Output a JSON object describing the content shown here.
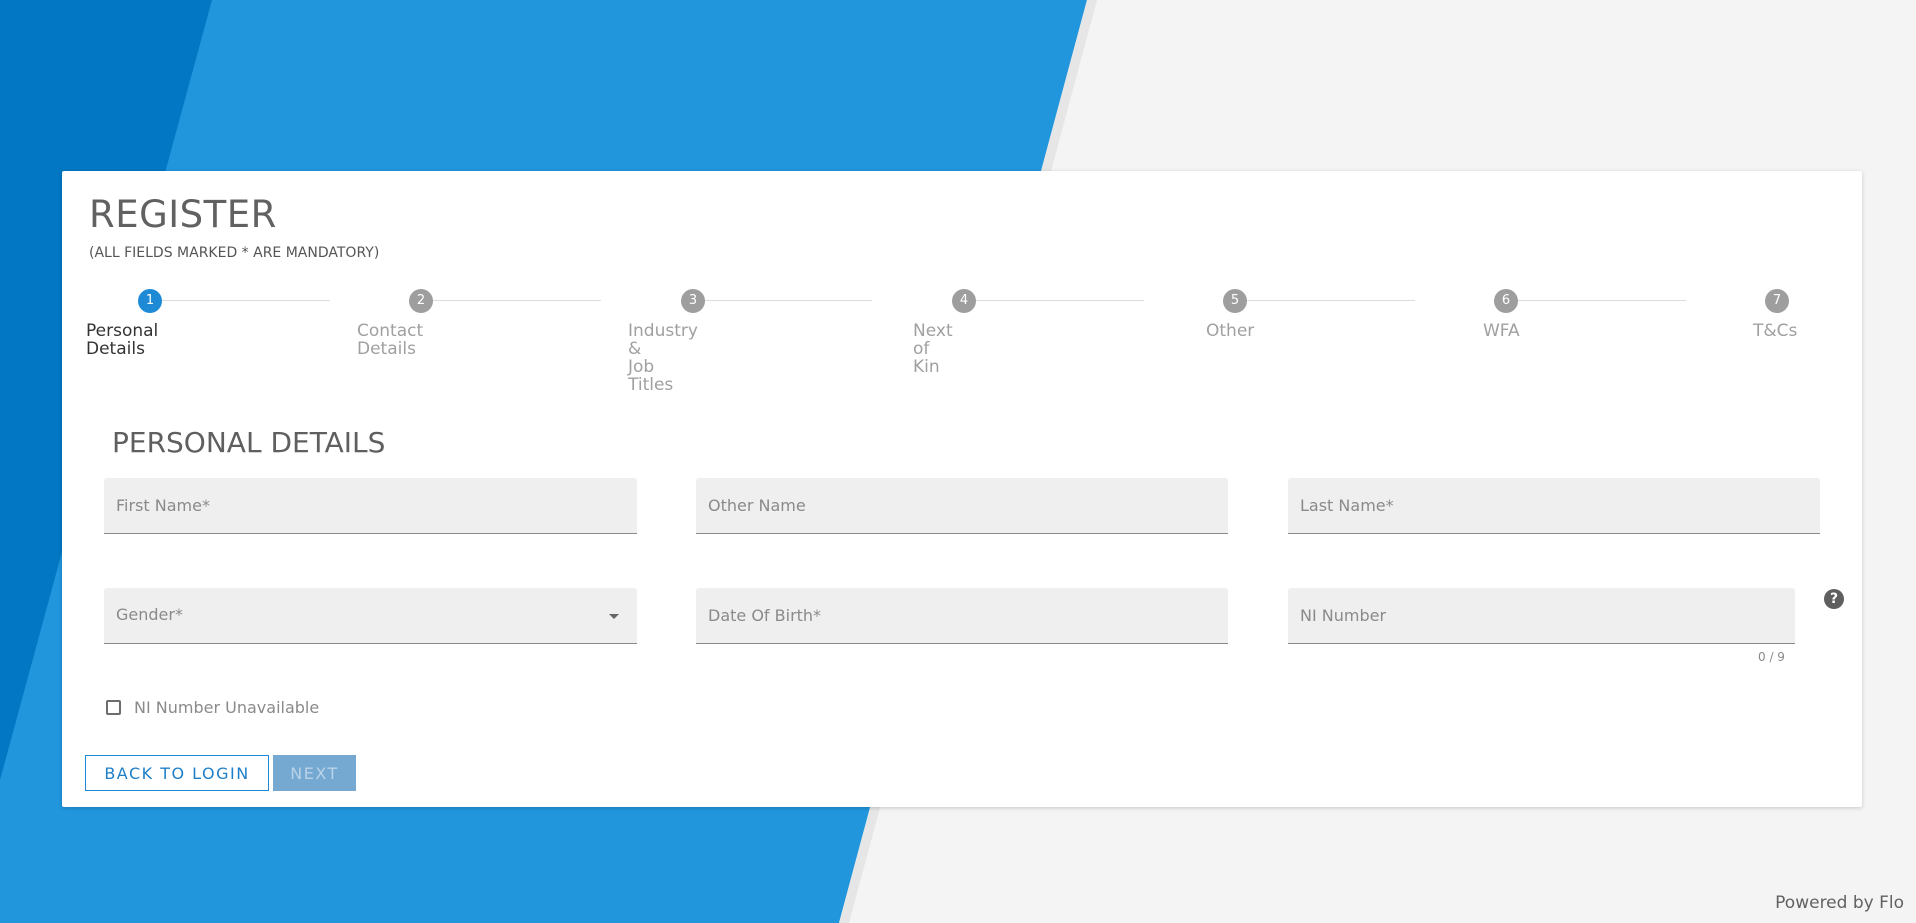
{
  "page": {
    "title": "REGISTER",
    "subtitle": "(ALL FIELDS MARKED * ARE MANDATORY)",
    "footer": "Powered by Flo",
    "colors": {
      "primary": "#1e8ad6",
      "background_blue": "#2196dd",
      "background_dark_blue": "#0277c4",
      "page_bg": "#f4f4f4"
    }
  },
  "stepper": {
    "active_index": 0,
    "steps": [
      {
        "number": "1",
        "label": "Personal\nDetails"
      },
      {
        "number": "2",
        "label": "Contact\nDetails"
      },
      {
        "number": "3",
        "label": "Industry &\nJob Titles"
      },
      {
        "number": "4",
        "label": "Next of Kin"
      },
      {
        "number": "5",
        "label": "Other"
      },
      {
        "number": "6",
        "label": "WFA"
      },
      {
        "number": "7",
        "label": "T&Cs"
      }
    ]
  },
  "form": {
    "section_title": "PERSONAL DETAILS",
    "first_name": {
      "placeholder": "First Name*",
      "value": ""
    },
    "other_name": {
      "placeholder": "Other Name",
      "value": ""
    },
    "last_name": {
      "placeholder": "Last Name*",
      "value": ""
    },
    "gender": {
      "placeholder": "Gender*"
    },
    "date_of_birth": {
      "placeholder": "Date Of Birth*",
      "value": ""
    },
    "ni_number": {
      "placeholder": "NI Number",
      "value": "",
      "counter": "0 / 9"
    },
    "help_icon": "question-circle-icon",
    "help_glyph": "?",
    "ni_unavailable": {
      "label": "NI Number Unavailable",
      "checked": false
    }
  },
  "buttons": {
    "back": "BACK TO LOGIN",
    "next": "NEXT"
  }
}
